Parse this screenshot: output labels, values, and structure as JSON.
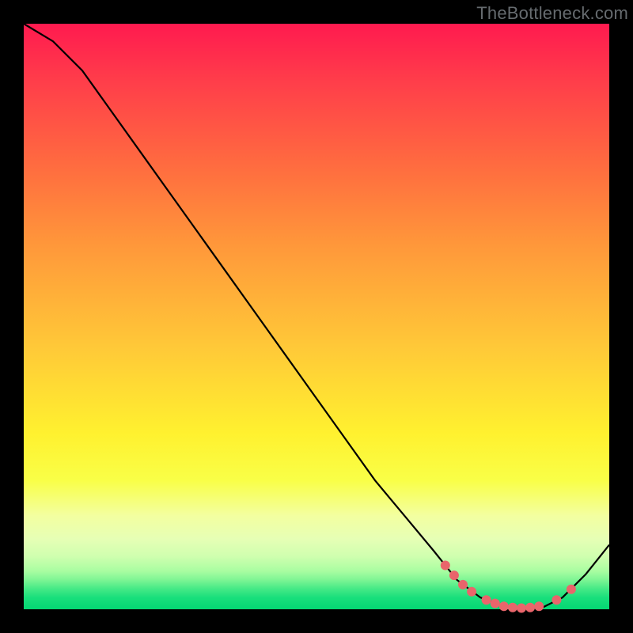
{
  "watermark": "TheBottleneck.com",
  "chart_data": {
    "type": "line",
    "title": "",
    "xlabel": "",
    "ylabel": "",
    "x_range": [
      0,
      100
    ],
    "y_range": [
      0,
      100
    ],
    "series": [
      {
        "name": "bottleneck-curve",
        "x": [
          0,
          5,
          10,
          15,
          20,
          25,
          30,
          35,
          40,
          45,
          50,
          55,
          60,
          65,
          70,
          74,
          78,
          82,
          85,
          88,
          92,
          96,
          100
        ],
        "y": [
          100,
          97,
          92,
          85,
          78,
          71,
          64,
          57,
          50,
          43,
          36,
          29,
          22,
          16,
          10,
          5,
          2,
          0.5,
          0,
          0,
          2,
          6,
          11
        ]
      }
    ],
    "markers": {
      "name": "highlighted-range",
      "x": [
        72,
        73.5,
        75,
        76.5,
        79,
        80.5,
        82,
        83.5,
        85,
        86.5,
        88,
        91,
        93.5
      ],
      "y": [
        7.5,
        5.8,
        4.2,
        3.0,
        1.6,
        1.0,
        0.5,
        0.3,
        0.2,
        0.3,
        0.5,
        1.6,
        3.4
      ]
    }
  },
  "colors": {
    "curve": "#000000",
    "marker": "#e9656b",
    "watermark": "#666b6f"
  }
}
